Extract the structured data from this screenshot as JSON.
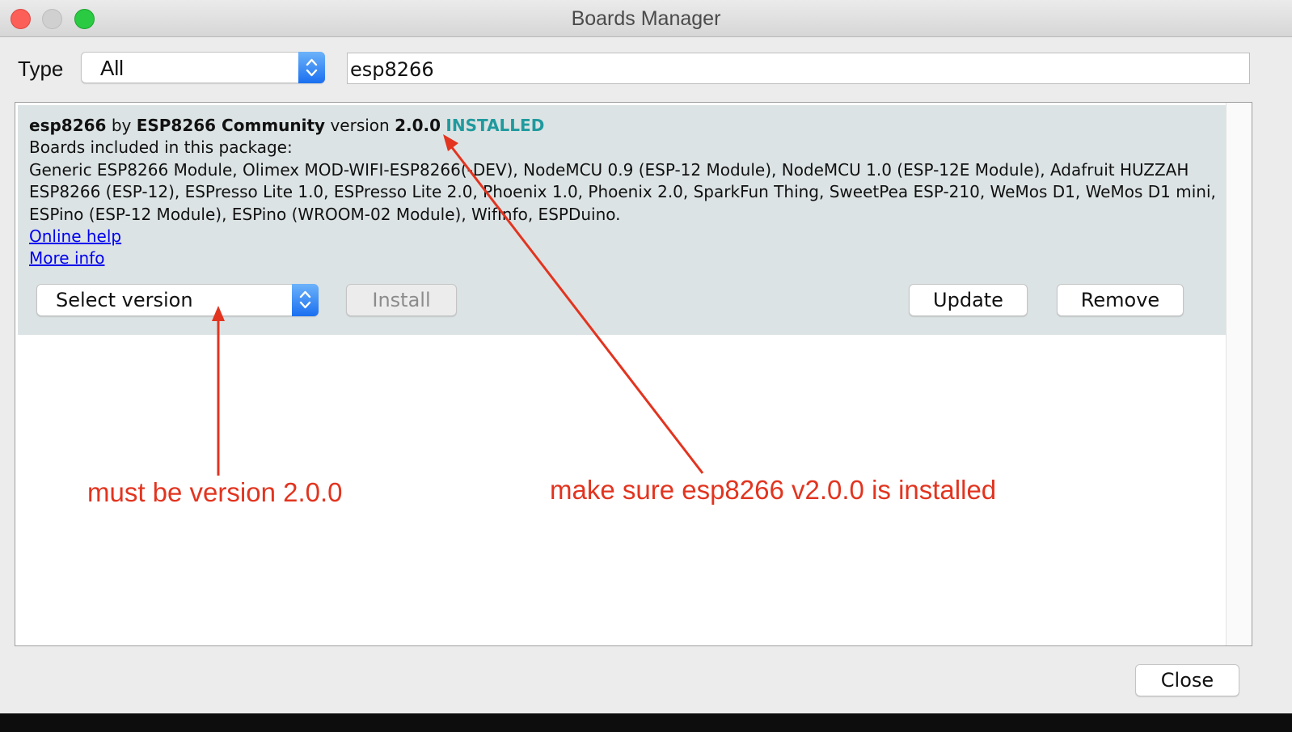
{
  "window": {
    "title": "Boards Manager"
  },
  "filter": {
    "type_label": "Type",
    "type_value": "All",
    "search_value": "esp8266"
  },
  "package": {
    "name": "esp8266",
    "by_text": "by",
    "author": "ESP8266 Community",
    "version_text": "version",
    "version": "2.0.0",
    "status": "INSTALLED",
    "boards_heading": "Boards included in this package:",
    "boards_list": "Generic ESP8266 Module, Olimex MOD-WIFI-ESP8266(-DEV), NodeMCU 0.9 (ESP-12 Module), NodeMCU 1.0 (ESP-12E Module), Adafruit HUZZAH ESP8266 (ESP-12), ESPresso Lite 1.0, ESPresso Lite 2.0, Phoenix 1.0, Phoenix 2.0, SparkFun Thing, SweetPea ESP-210, WeMos D1, WeMos D1 mini, ESPino (ESP-12 Module), ESPino (WROOM-02 Module), WifInfo, ESPDuino.",
    "online_help": "Online help",
    "more_info": "More info",
    "select_version": "Select version",
    "install_label": "Install",
    "update_label": "Update",
    "remove_label": "Remove"
  },
  "annotations": {
    "left_note": "must be version 2.0.0",
    "right_note": "make sure esp8266 v2.0.0 is installed",
    "color": "#e2341f"
  },
  "footer": {
    "close_label": "Close"
  },
  "colors": {
    "installed": "#1f9a9e",
    "link": "#0000ee",
    "entry_bg": "#dce3e4",
    "accent": "#1a6ff0"
  }
}
